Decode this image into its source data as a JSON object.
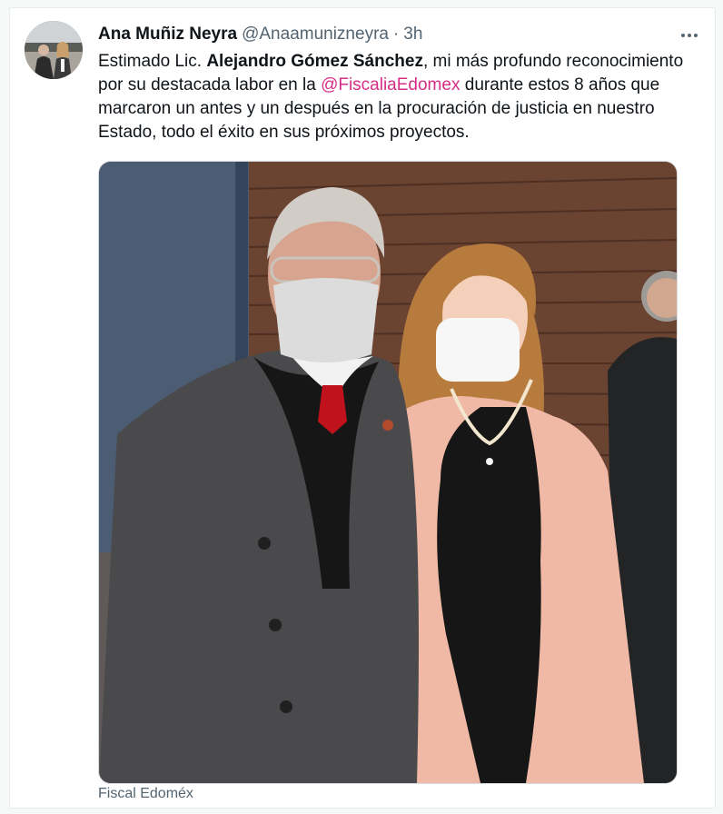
{
  "tweet": {
    "display_name": "Ana Muñiz Neyra",
    "handle": "@Anaamunizneyra",
    "separator": "·",
    "timestamp": "3h",
    "text_parts": {
      "intro": "Estimado Lic. ",
      "bold_name": "Alejandro Gómez Sánchez",
      "middle": ", mi más profundo reconocimiento por su destacada labor en la ",
      "mention": "@FiscaliaEdomex",
      "ending": " durante estos 8 años que marcaron un antes y un después en la procuración de justicia en nuestro Estado, todo el éxito en sus próximos proyectos."
    },
    "media_caption": "Fiscal Edoméx",
    "more_icon": "more-horizontal-icon"
  },
  "colors": {
    "mention": "#d62e86",
    "text": "#0f1419",
    "secondary": "#536471",
    "blazer": "#f0b9a5",
    "suit": "#4a4a4d",
    "tie": "#c0121d",
    "wood_wall": "#6a4331"
  }
}
